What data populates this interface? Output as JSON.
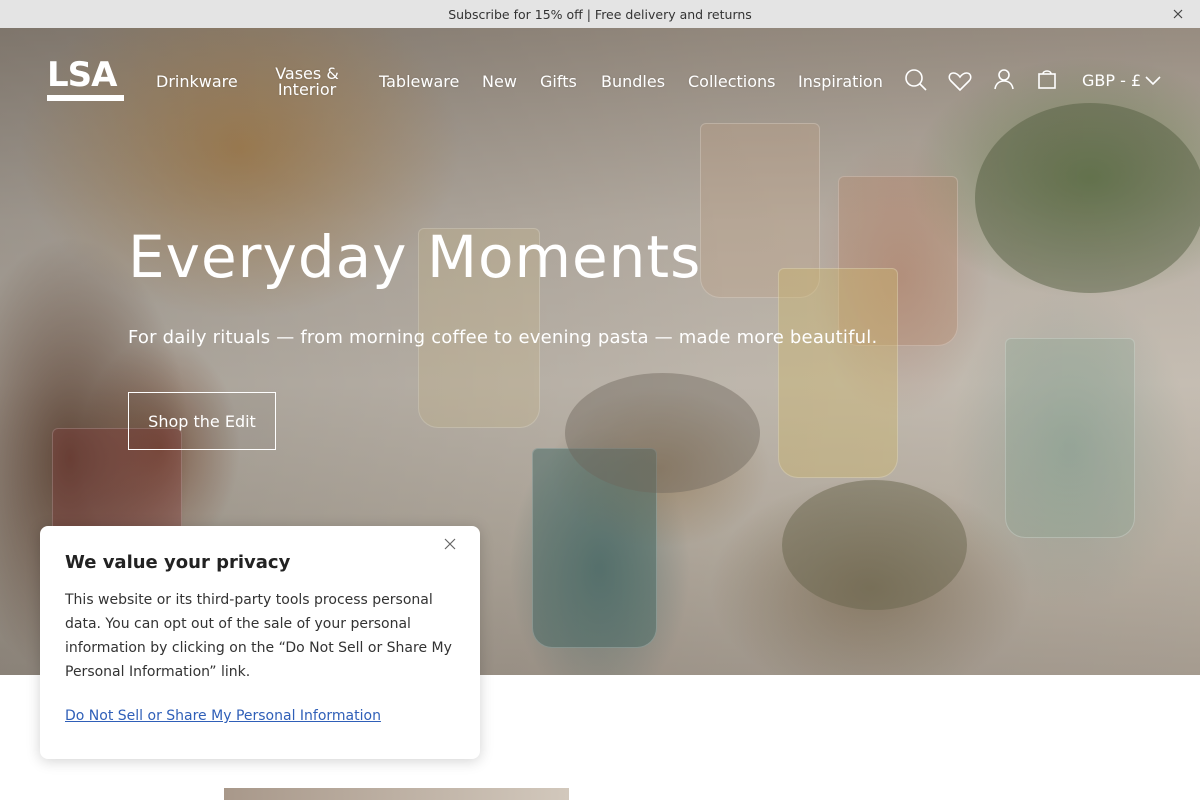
{
  "announcement": {
    "text": "Subscribe for 15% off | Free delivery and returns",
    "close_icon": "close-icon"
  },
  "header": {
    "logo_text": "LSA",
    "nav": [
      {
        "label": "Drinkware"
      },
      {
        "label": "Vases & Interior"
      },
      {
        "label": "Tableware"
      },
      {
        "label": "New"
      },
      {
        "label": "Gifts"
      },
      {
        "label": "Bundles"
      },
      {
        "label": "Collections"
      },
      {
        "label": "Inspiration"
      }
    ],
    "icons": [
      "search-icon",
      "heart-icon",
      "account-icon",
      "bag-icon"
    ],
    "currency": "GBP - £"
  },
  "hero": {
    "title": "Everyday Moments",
    "subtitle": "For daily rituals — from morning coffee to evening pasta — made more beautiful.",
    "cta": "Shop the Edit"
  },
  "privacy": {
    "title": "We value your privacy",
    "body": "This website or its third-party tools process personal data. You can opt out of the sale of your personal information by clicking on the “Do Not Sell or Share My Personal Information” link.",
    "link": "Do Not Sell or Share My Personal Information",
    "link_color": "#2f5fb8"
  }
}
